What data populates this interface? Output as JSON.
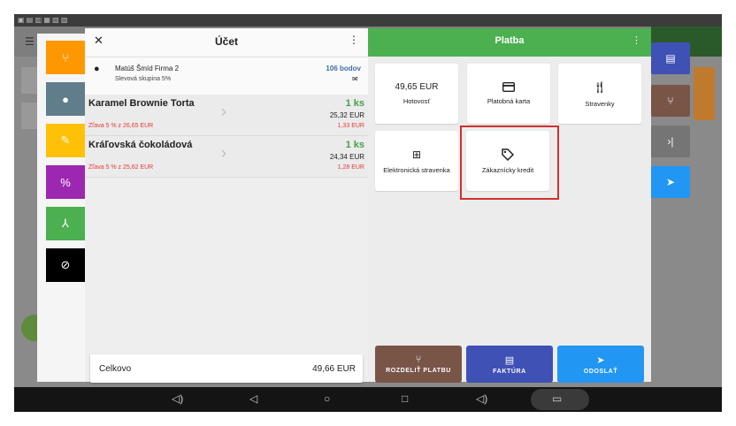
{
  "left": {
    "title": "Účet",
    "customer": {
      "name": "Matúš Šmíd Firma 2",
      "group": "Slevová skupina 5%",
      "points": "106 bodov"
    },
    "items": [
      {
        "name": "Karamel Brownie Torta",
        "qty": "1 ks",
        "price": "25,32 EUR",
        "discount_note": "Zľava 5 % z 26,65 EUR",
        "discount": "1,33 EUR"
      },
      {
        "name": "Kráľovská čokoládová",
        "qty": "1 ks",
        "price": "24,34 EUR",
        "discount_note": "Zľava 5 % z 25,62 EUR",
        "discount": "1,28 EUR"
      }
    ],
    "total_label": "Celkovo",
    "total_value": "49,66 EUR"
  },
  "right": {
    "title": "Platba",
    "tiles": [
      {
        "top": "49,65 EUR",
        "label": "Hotovosť"
      },
      {
        "label": "Platobná karta"
      },
      {
        "label": "Stravenky"
      },
      {
        "label": "Elektronická stravenka"
      },
      {
        "label": "Zákaznícky kredit"
      }
    ],
    "actions": [
      {
        "label": "ROZDELIŤ PLATBU"
      },
      {
        "label": "FAKTÚRA"
      },
      {
        "label": "ODOSLAŤ"
      }
    ]
  },
  "colors": {
    "green": "#4caf50",
    "brown": "#795548",
    "indigo": "#3f51b5",
    "blue": "#2196f3",
    "highlight": "#d32f2f"
  }
}
